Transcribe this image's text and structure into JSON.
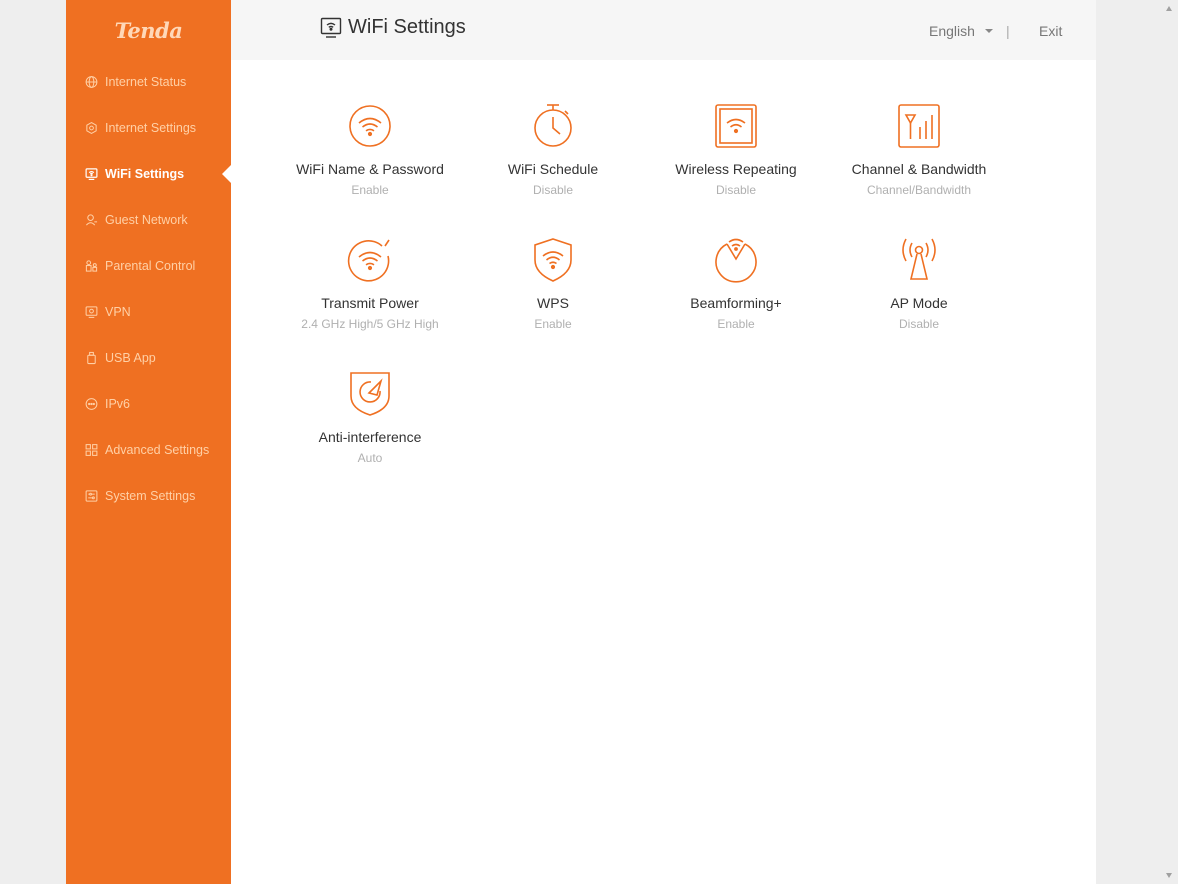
{
  "brand": {
    "logo_text": "Tenda",
    "accent": "#ef7022"
  },
  "header": {
    "title": "WiFi Settings",
    "title_icon": "wifi-monitor-icon",
    "language": "English",
    "divider": "|",
    "exit_label": "Exit"
  },
  "sidebar": {
    "items": [
      {
        "label": "Internet Status",
        "icon": "globe-icon",
        "active": false
      },
      {
        "label": "Internet Settings",
        "icon": "gear-icon",
        "active": false
      },
      {
        "label": "WiFi Settings",
        "icon": "wifi-monitor-icon",
        "active": true
      },
      {
        "label": "Guest Network",
        "icon": "guest-user-icon",
        "active": false
      },
      {
        "label": "Parental Control",
        "icon": "family-icon",
        "active": false
      },
      {
        "label": "VPN",
        "icon": "vpn-monitor-icon",
        "active": false
      },
      {
        "label": "USB App",
        "icon": "usb-icon",
        "active": false
      },
      {
        "label": "IPv6",
        "icon": "ipv6-icon",
        "active": false
      },
      {
        "label": "Advanced Settings",
        "icon": "grid-icon",
        "active": false
      },
      {
        "label": "System Settings",
        "icon": "system-settings-icon",
        "active": false
      }
    ]
  },
  "tiles": [
    {
      "label": "WiFi Name & Password",
      "status": "Enable",
      "icon": "wifi-circle-icon"
    },
    {
      "label": "WiFi Schedule",
      "status": "Disable",
      "icon": "stopwatch-icon"
    },
    {
      "label": "Wireless Repeating",
      "status": "Disable",
      "icon": "wifi-square-icon"
    },
    {
      "label": "Channel & Bandwidth",
      "status": "Channel/Bandwidth",
      "icon": "signal-bars-icon"
    },
    {
      "label": "Transmit Power",
      "status": "2.4 GHz High/5 GHz High",
      "icon": "wifi-power-icon"
    },
    {
      "label": "WPS",
      "status": "Enable",
      "icon": "wifi-shield-icon"
    },
    {
      "label": "Beamforming+",
      "status": "Enable",
      "icon": "beamforming-icon"
    },
    {
      "label": "AP Mode",
      "status": "Disable",
      "icon": "antenna-icon"
    },
    {
      "label": "Anti-interference",
      "status": "Auto",
      "icon": "anti-interference-icon"
    }
  ]
}
